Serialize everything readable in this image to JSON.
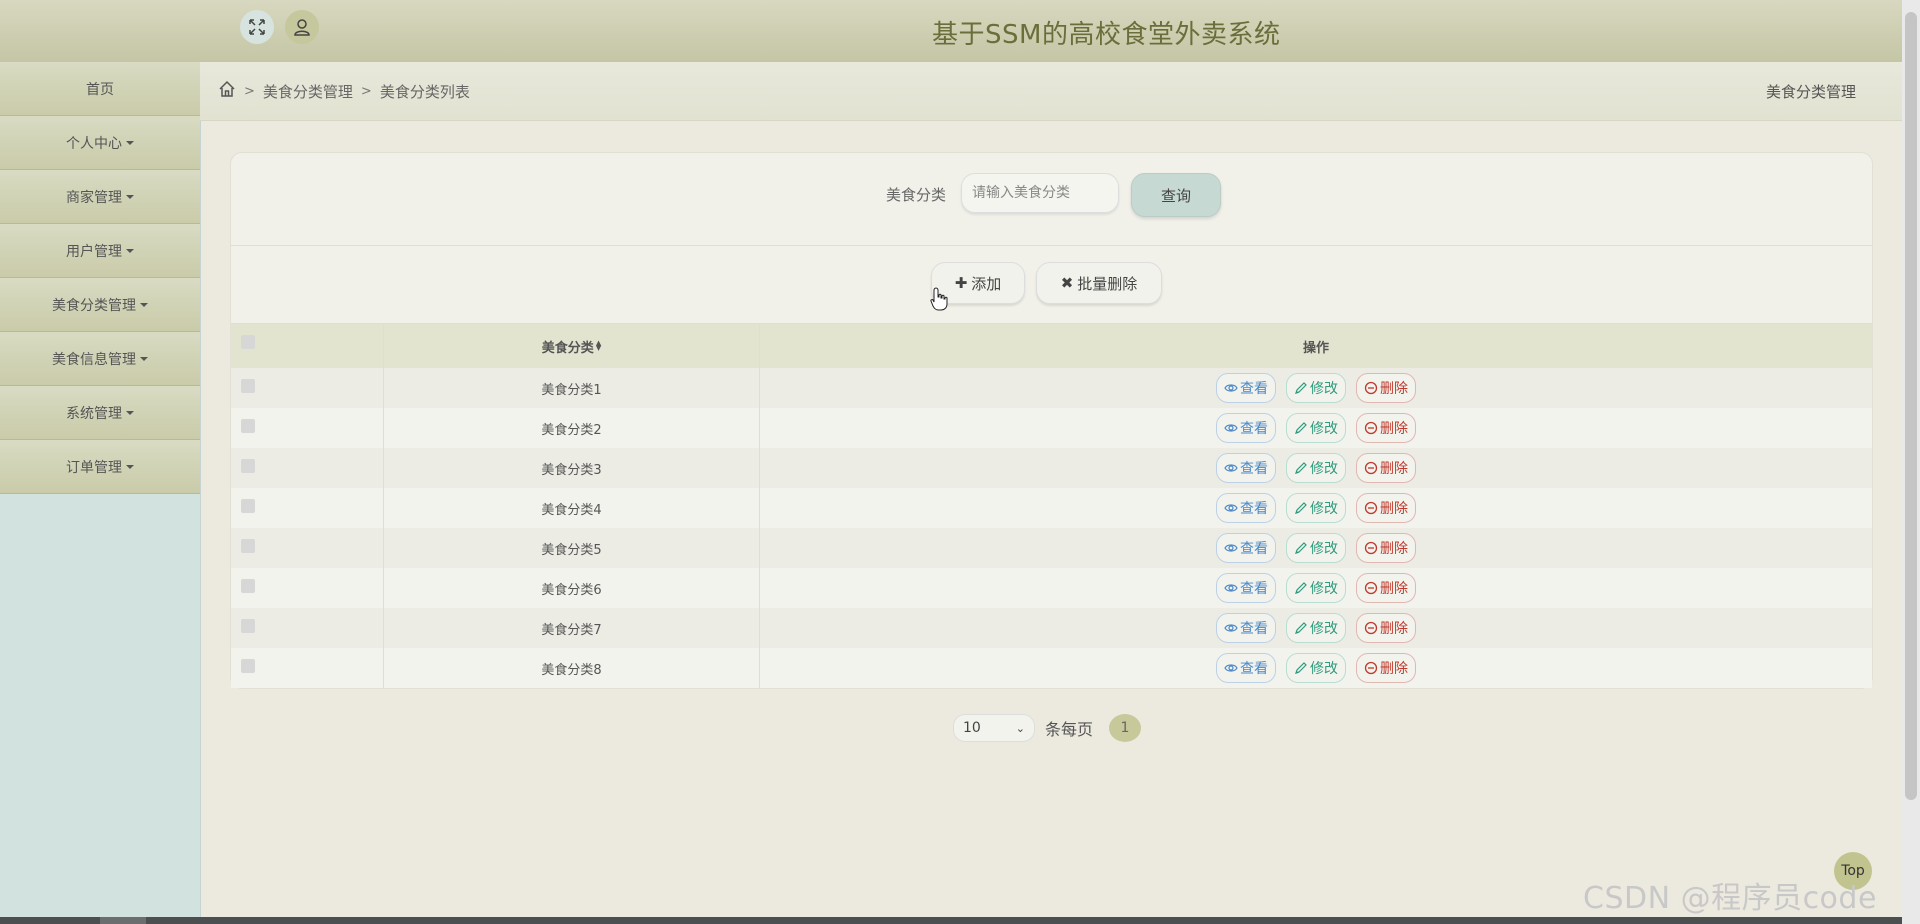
{
  "header": {
    "title": "基于SSM的高校食堂外卖系统",
    "expand_icon": "expand-icon",
    "user_icon": "user-icon"
  },
  "sidebar": {
    "items": [
      {
        "label": "首页",
        "has_caret": false
      },
      {
        "label": "个人中心",
        "has_caret": true
      },
      {
        "label": "商家管理",
        "has_caret": true
      },
      {
        "label": "用户管理",
        "has_caret": true
      },
      {
        "label": "美食分类管理",
        "has_caret": true
      },
      {
        "label": "美食信息管理",
        "has_caret": true
      },
      {
        "label": "系统管理",
        "has_caret": true
      },
      {
        "label": "订单管理",
        "has_caret": true
      }
    ]
  },
  "breadcrumb": {
    "home_icon": "home-icon",
    "sep": ">",
    "items": [
      "美食分类管理",
      "美食分类列表"
    ],
    "right_title": "美食分类管理"
  },
  "search": {
    "label": "美食分类",
    "placeholder": "请输入美食分类",
    "button_label": "查询"
  },
  "actions": {
    "add_label": "添加",
    "batch_delete_label": "批量删除"
  },
  "table": {
    "columns": [
      "美食分类",
      "操作"
    ],
    "rows": [
      "美食分类1",
      "美食分类2",
      "美食分类3",
      "美食分类4",
      "美食分类5",
      "美食分类6",
      "美食分类7",
      "美食分类8"
    ],
    "row_actions": {
      "view": "查看",
      "edit": "修改",
      "delete": "删除"
    }
  },
  "pagination": {
    "page_size": "10",
    "per_page_label": "条每页",
    "current_page": "1"
  },
  "top_button": "Top",
  "watermark": "CSDN @程序员code"
}
